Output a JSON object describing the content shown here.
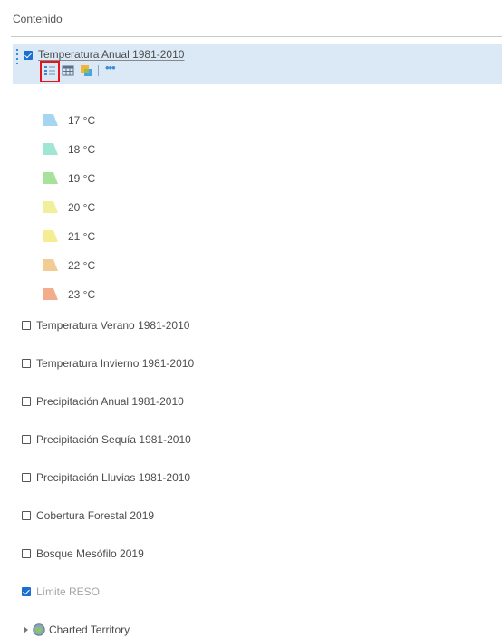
{
  "panel": {
    "title": "Contenido"
  },
  "selected_layer": {
    "label": "Temperatura Anual 1981-2010",
    "checked": true,
    "tools": {
      "legend_icon": "legend-icon",
      "table_icon": "attribute-table-icon",
      "style_icon": "change-style-icon",
      "more": "•••"
    },
    "legend": [
      {
        "label": "17 °C",
        "color": "#a6d6ef"
      },
      {
        "label": "18 °C",
        "color": "#9fe6d4"
      },
      {
        "label": "19 °C",
        "color": "#a8e29a"
      },
      {
        "label": "20 °C",
        "color": "#f2ef9c"
      },
      {
        "label": "21 °C",
        "color": "#f6ec92"
      },
      {
        "label": "22 °C",
        "color": "#f2cc95"
      },
      {
        "label": "23 °C",
        "color": "#f1ad8c"
      }
    ]
  },
  "layers": [
    {
      "label": "Temperatura Verano 1981-2010",
      "checked": false
    },
    {
      "label": "Temperatura Invierno 1981-2010",
      "checked": false
    },
    {
      "label": "Precipitación Anual 1981-2010",
      "checked": false
    },
    {
      "label": "Precipitación Sequía 1981-2010",
      "checked": false
    },
    {
      "label": "Precipitación Lluvias 1981-2010",
      "checked": false
    },
    {
      "label": "Cobertura Forestal 2019",
      "checked": false
    },
    {
      "label": "Bosque Mesófilo 2019",
      "checked": false
    },
    {
      "label": "Límite RESO",
      "checked": true
    }
  ],
  "group_layer": {
    "label": "Charted Territory",
    "icon": "globe-icon"
  },
  "colors": {
    "selection_bg": "#dbe9f7",
    "checkbox_checked": "#1a6fd1",
    "highlight": "#e8141b"
  }
}
